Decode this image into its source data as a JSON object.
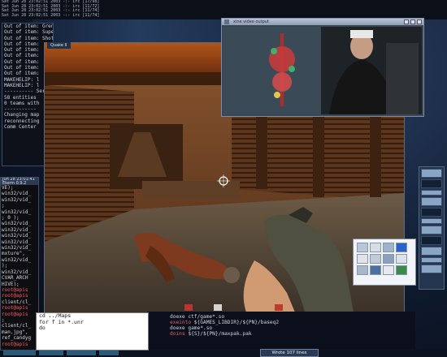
{
  "topbar": {
    "log_lines": [
      "Sat Jun 28 23:02:51 2003 -:- irc [17/98]",
      "Sat Jun 28 23:02:51 2003 -:- irc [11/72]",
      "Sat Jun 28 23:02:51 2003 -:- irc [11/74]",
      "Sat Jun 28 23:02:51 2003 -:- irc [11/74]"
    ]
  },
  "console": {
    "lines": [
      "Out of item: Grenade Launcher",
      "Out of item: Super Shotgun",
      "Out of item: Shotgun",
      "Out of item:",
      "Out of item:",
      "Out of item:",
      "Out of item:",
      "Out of item:",
      "Out of item:",
      "MAKEHELIP: l",
      "MAKEHELIP: l",
      "---------- Serv",
      "58 entities",
      "0 teams with",
      "-----------",
      "",
      "Changing map",
      "reconnecting",
      "",
      "",
      "",
      "",
      "Comm Center"
    ]
  },
  "game": {
    "title": "Quake II"
  },
  "video": {
    "title": "xine video output"
  },
  "terminal": {
    "title_lines": [
      "Jun 28 23:01:41",
      "Eterm 0.9.2"
    ],
    "lines": [
      {
        "t": "VE);",
        "c": ""
      },
      {
        "t": "win32/vid_",
        "c": ""
      },
      {
        "t": "win32/vid_",
        "c": ""
      },
      {
        "t": ";",
        "c": ""
      },
      {
        "t": "win32/vid_",
        "c": ""
      },
      {
        "t": "; 0 );",
        "c": ""
      },
      {
        "t": "win32/vid_",
        "c": ""
      },
      {
        "t": "win32/vid_",
        "c": ""
      },
      {
        "t": "win32/vid_",
        "c": ""
      },
      {
        "t": "win32/vid_",
        "c": ""
      },
      {
        "t": "win32/vid_",
        "c": ""
      },
      {
        "t": "mxture\",",
        "c": ""
      },
      {
        "t": "win32/vid_",
        "c": ""
      },
      {
        "t": "  );",
        "c": ""
      },
      {
        "t": "win32/vid_",
        "c": ""
      },
      {
        "t": "CVAR_ARCH",
        "c": ""
      },
      {
        "t": "HIVE);",
        "c": ""
      },
      {
        "t": "root@apis",
        "c": "red"
      },
      {
        "t": "root@apis",
        "c": "red"
      },
      {
        "t": "client/cl_",
        "c": ""
      },
      {
        "t": "root@apis",
        "c": "red"
      },
      {
        "t": "root@apis",
        "c": "red"
      },
      {
        "t": ";",
        "c": ""
      },
      {
        "t": "client/cl_",
        "c": ""
      },
      {
        "t": "man.jpg\",",
        "c": ""
      },
      {
        "t": "ref_candyg",
        "c": ""
      },
      {
        "t": "root@apis",
        "c": "red"
      }
    ]
  },
  "shell": {
    "lines": [
      "cd ../Maps",
      "for f in *.unr",
      "do"
    ]
  },
  "editor": {
    "lines": [
      {
        "kw": "",
        "rest": "doexe ctf/game*.so"
      },
      {
        "kw": "exeinto",
        "rest": " ${GAMES_LIBDIR}/${PN}/baseq2"
      },
      {
        "kw": "",
        "rest": "doexe game*.so"
      },
      {
        "kw": "doins",
        "rest": " ${S}/${PN}/maxpak.pak"
      }
    ],
    "status": "Wrote 107 lines"
  },
  "colors": {
    "accent": "#2a5c7a",
    "terminal_prompt": "#ff5b5b"
  }
}
